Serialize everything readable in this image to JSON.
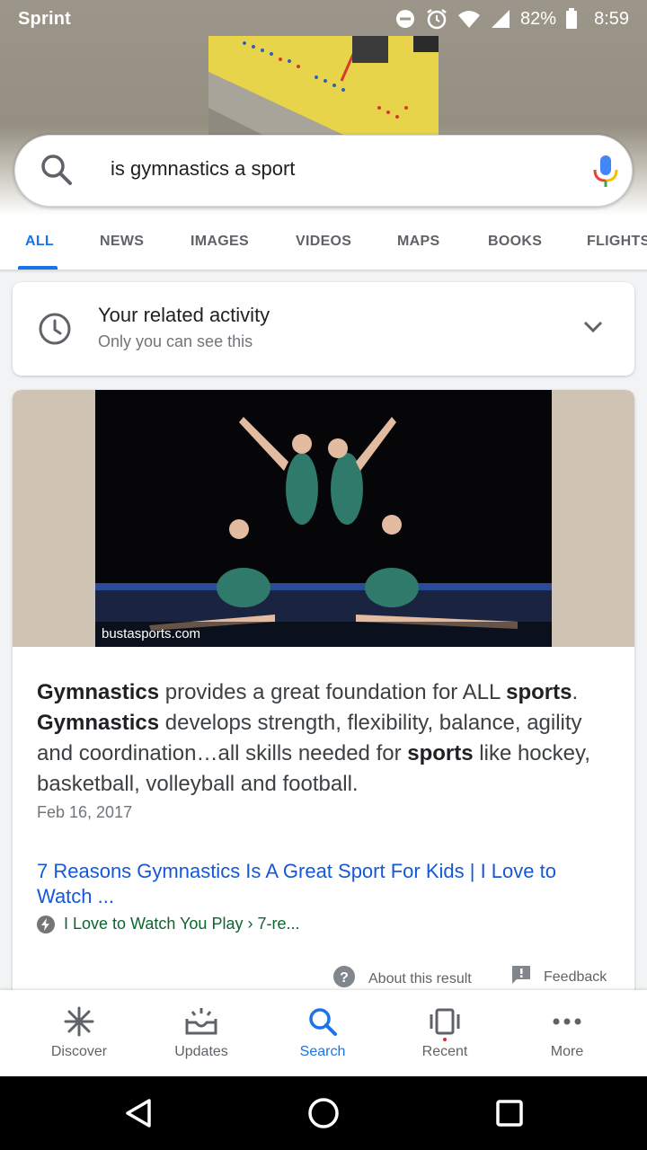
{
  "status_bar": {
    "carrier": "Sprint",
    "battery": "82%",
    "time": "8:59"
  },
  "search": {
    "query": "is gymnastics a sport"
  },
  "tabs": [
    {
      "label": "ALL",
      "active": true
    },
    {
      "label": "NEWS"
    },
    {
      "label": "IMAGES"
    },
    {
      "label": "VIDEOS"
    },
    {
      "label": "MAPS"
    },
    {
      "label": "BOOKS"
    },
    {
      "label": "FLIGHTS"
    }
  ],
  "activity_card": {
    "title": "Your related activity",
    "subtitle": "Only you can see this"
  },
  "result": {
    "image_source": "bustasports.com",
    "snippet_parts": [
      {
        "text": "Gymnastics",
        "bold": true
      },
      {
        "text": " provides a great foundation for ALL ",
        "bold": false
      },
      {
        "text": "sports",
        "bold": true
      },
      {
        "text": ". ",
        "bold": false
      },
      {
        "text": "Gymnastics",
        "bold": true
      },
      {
        "text": " develops strength, flexibility, balance, agility and coordination…all skills needed for ",
        "bold": false
      },
      {
        "text": "sports",
        "bold": true
      },
      {
        "text": " like hockey, basketball, volleyball and football.",
        "bold": false
      }
    ],
    "date": "Feb 16, 2017",
    "link_title": "7 Reasons Gymnastics Is A Great Sport For Kids | I Love to Watch ...",
    "url": "I Love to Watch You Play › 7-re...",
    "about_label": "About this result",
    "feedback_label": "Feedback"
  },
  "bottom_nav": [
    {
      "label": "Discover",
      "icon": "asterisk-icon"
    },
    {
      "label": "Updates",
      "icon": "inbox-icon"
    },
    {
      "label": "Search",
      "icon": "search-icon",
      "active": true
    },
    {
      "label": "Recent",
      "icon": "recent-cards-icon"
    },
    {
      "label": "More",
      "icon": "more-dots-icon"
    }
  ],
  "colors": {
    "accent": "#1a73e8",
    "link": "#1558d6",
    "url_green": "#0d652d"
  }
}
